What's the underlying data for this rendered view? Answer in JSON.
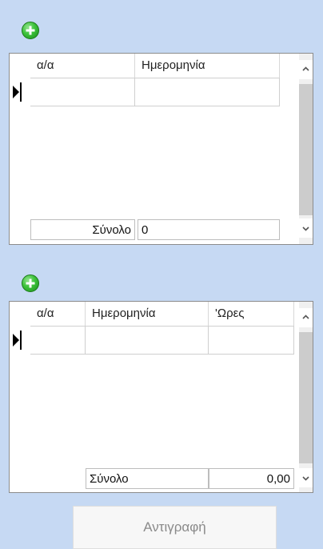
{
  "grid1": {
    "col_aa": "α/α",
    "col_date": "Ημερομηνία",
    "total_label": "Σύνολο",
    "total_value": "0"
  },
  "grid2": {
    "col_aa": "α/α",
    "col_date": "Ημερομηνία",
    "col_hours": "'Ωρες",
    "total_label": "Σύνολο",
    "total_value": "0,00"
  },
  "copy_button": "Αντιγραφή"
}
